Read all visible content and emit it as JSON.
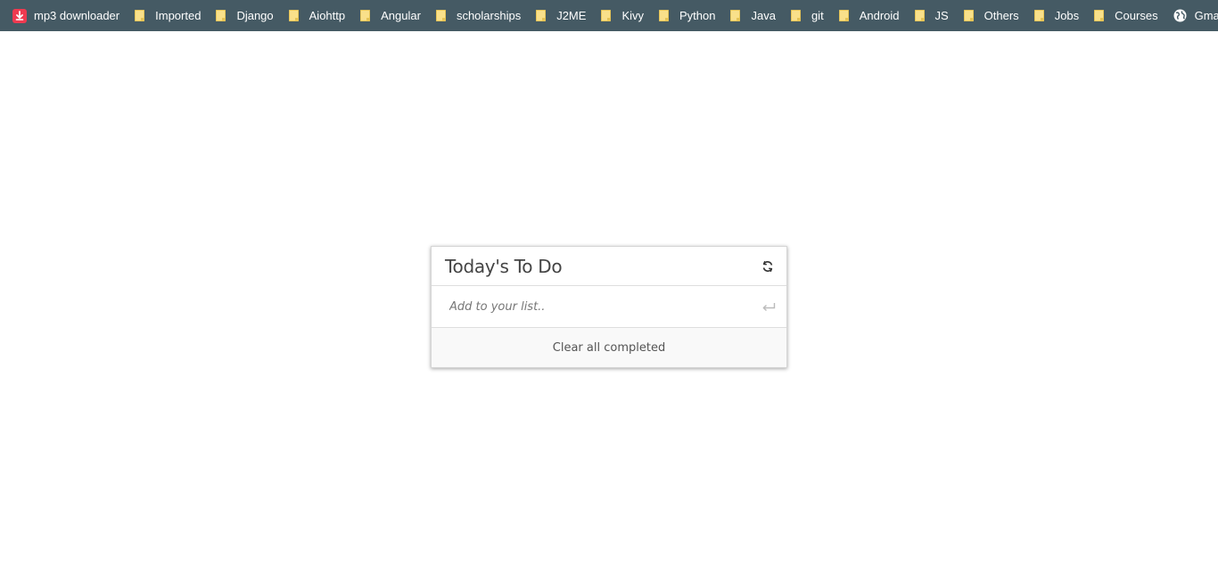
{
  "bookmarks_bar": {
    "items": [
      {
        "label": "mp3 downloader",
        "icon": "download-icon"
      },
      {
        "label": "Imported",
        "icon": "folder-icon"
      },
      {
        "label": "Django",
        "icon": "folder-icon"
      },
      {
        "label": "Aiohttp",
        "icon": "folder-icon"
      },
      {
        "label": "Angular",
        "icon": "folder-icon"
      },
      {
        "label": "scholarships",
        "icon": "folder-icon"
      },
      {
        "label": "J2ME",
        "icon": "folder-icon"
      },
      {
        "label": "Kivy",
        "icon": "folder-icon"
      },
      {
        "label": "Python",
        "icon": "folder-icon"
      },
      {
        "label": "Java",
        "icon": "folder-icon"
      },
      {
        "label": "git",
        "icon": "folder-icon"
      },
      {
        "label": "Android",
        "icon": "folder-icon"
      },
      {
        "label": "JS",
        "icon": "folder-icon"
      },
      {
        "label": "Others",
        "icon": "folder-icon"
      },
      {
        "label": "Jobs",
        "icon": "folder-icon"
      },
      {
        "label": "Courses",
        "icon": "folder-icon"
      },
      {
        "label": "Gmail",
        "icon": "globe-icon"
      }
    ],
    "overflow_icon": "chevron-double-right-icon",
    "background_color": "#455a64"
  },
  "todo": {
    "title": "Today's To Do",
    "refresh_icon": "refresh-icon",
    "input_placeholder": "Add to your list..",
    "input_value": "",
    "enter_icon": "enter-icon",
    "clear_label": "Clear all completed"
  }
}
